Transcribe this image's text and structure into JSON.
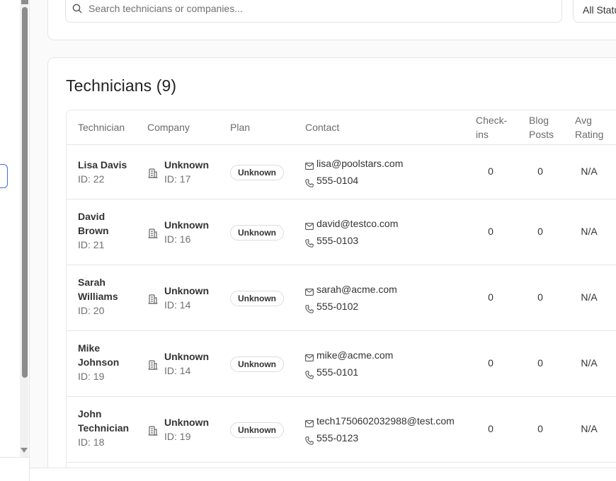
{
  "search": {
    "placeholder": "Search technicians or companies...",
    "value": ""
  },
  "status_filter": {
    "selected": "All Status"
  },
  "card": {
    "title": "Technicians (9)"
  },
  "table": {
    "headers": {
      "technician": "Technician",
      "company": "Company",
      "plan": "Plan",
      "contact": "Contact",
      "checkins_line1": "Check-",
      "checkins_line2": "ins",
      "blog_line1": "Blog",
      "blog_line2": "Posts",
      "rating_line1": "Avg",
      "rating_line2": "Rating"
    },
    "rows": [
      {
        "name_line1": "Lisa Davis",
        "name_line2": "",
        "tech_id": "ID: 22",
        "company": "Unknown",
        "company_id": "ID: 17",
        "plan": "Unknown",
        "email": "lisa@poolstars.com",
        "phone": "555-0104",
        "checkins": "0",
        "blog_posts": "0",
        "avg_rating": "N/A"
      },
      {
        "name_line1": "David",
        "name_line2": "Brown",
        "tech_id": "ID: 21",
        "company": "Unknown",
        "company_id": "ID: 16",
        "plan": "Unknown",
        "email": "david@testco.com",
        "phone": "555-0103",
        "checkins": "0",
        "blog_posts": "0",
        "avg_rating": "N/A"
      },
      {
        "name_line1": "Sarah",
        "name_line2": "Williams",
        "tech_id": "ID: 20",
        "company": "Unknown",
        "company_id": "ID: 14",
        "plan": "Unknown",
        "email": "sarah@acme.com",
        "phone": "555-0102",
        "checkins": "0",
        "blog_posts": "0",
        "avg_rating": "N/A"
      },
      {
        "name_line1": "Mike",
        "name_line2": "Johnson",
        "tech_id": "ID: 19",
        "company": "Unknown",
        "company_id": "ID: 14",
        "plan": "Unknown",
        "email": "mike@acme.com",
        "phone": "555-0101",
        "checkins": "0",
        "blog_posts": "0",
        "avg_rating": "N/A"
      },
      {
        "name_line1": "John",
        "name_line2": "Technician",
        "tech_id": "ID: 18",
        "company": "Unknown",
        "company_id": "ID: 19",
        "plan": "Unknown",
        "email": "tech1750602032988@test.com",
        "phone": "555-0123",
        "checkins": "0",
        "blog_posts": "0",
        "avg_rating": "N/A"
      }
    ]
  },
  "colors": {
    "accent": "#3b6fd8",
    "border": "#e6e6e6",
    "muted_text": "#6b6b6b"
  }
}
